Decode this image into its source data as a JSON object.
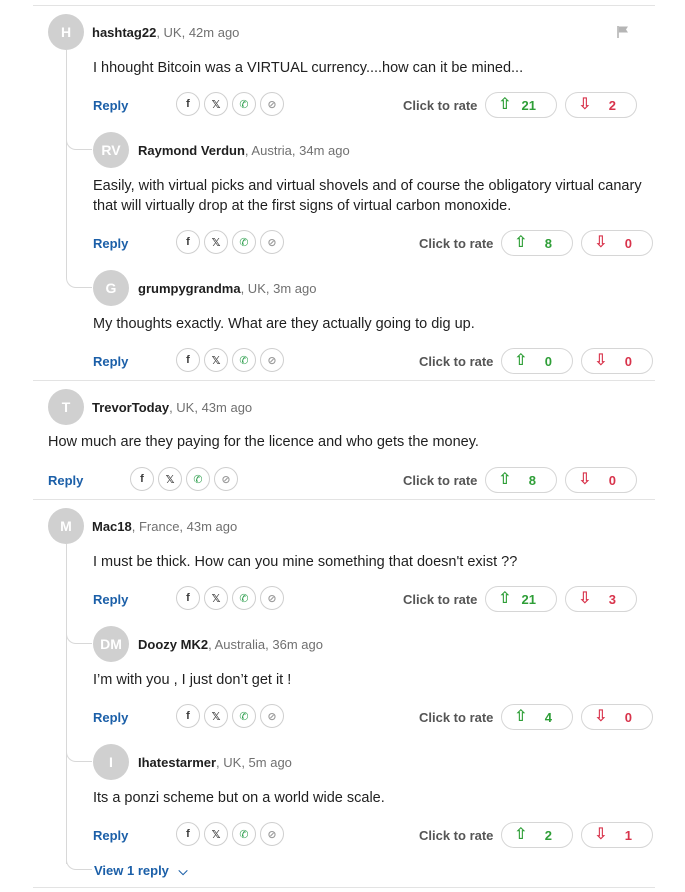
{
  "colors": {
    "accent": "#1b5fa8",
    "up": "#2e9e37",
    "down": "#d8334b",
    "avatar": "#d0d0d0"
  },
  "actions": {
    "reply_label": "Reply",
    "rate_label": "Click to rate"
  },
  "share_icons": [
    "facebook-icon",
    "x-icon",
    "whatsapp-icon",
    "link-icon"
  ],
  "comments": [
    {
      "initials": "H",
      "username": "hashtag22",
      "meta": ", UK, 42m ago",
      "text": "I hhought Bitcoin was a VIRTUAL currency....how can it be mined...",
      "up": "21",
      "down": "2"
    },
    {
      "initials": "RV",
      "username": "Raymond Verdun",
      "meta": ", Austria, 34m ago",
      "text": "Easily, with virtual picks and virtual shovels and of course the obligatory virtual canary that will virtually drop at the first signs of virtual carbon monoxide.",
      "up": "8",
      "down": "0"
    },
    {
      "initials": "G",
      "username": "grumpygrandma",
      "meta": ", UK, 3m ago",
      "text": "My thoughts exactly. What are they actually going to dig up.",
      "up": "0",
      "down": "0"
    },
    {
      "initials": "T",
      "username": "TrevorToday",
      "meta": ", UK, 43m ago",
      "text": "How much are they paying for the licence and who gets the money.",
      "up": "8",
      "down": "0"
    },
    {
      "initials": "M",
      "username": "Mac18",
      "meta": ", France, 43m ago",
      "text": "I must be thick. How can you mine something that doesn't exist ??",
      "up": "21",
      "down": "3"
    },
    {
      "initials": "DM",
      "username": "Doozy MK2",
      "meta": ", Australia, 36m ago",
      "text": "I’m with you , I just don’t get it !",
      "up": "4",
      "down": "0"
    },
    {
      "initials": "I",
      "username": "Ihatestarmer",
      "meta": ", UK, 5m ago",
      "text": "Its a ponzi scheme but on a world wide scale.",
      "up": "2",
      "down": "1"
    }
  ],
  "view_replies": "View 1 reply"
}
